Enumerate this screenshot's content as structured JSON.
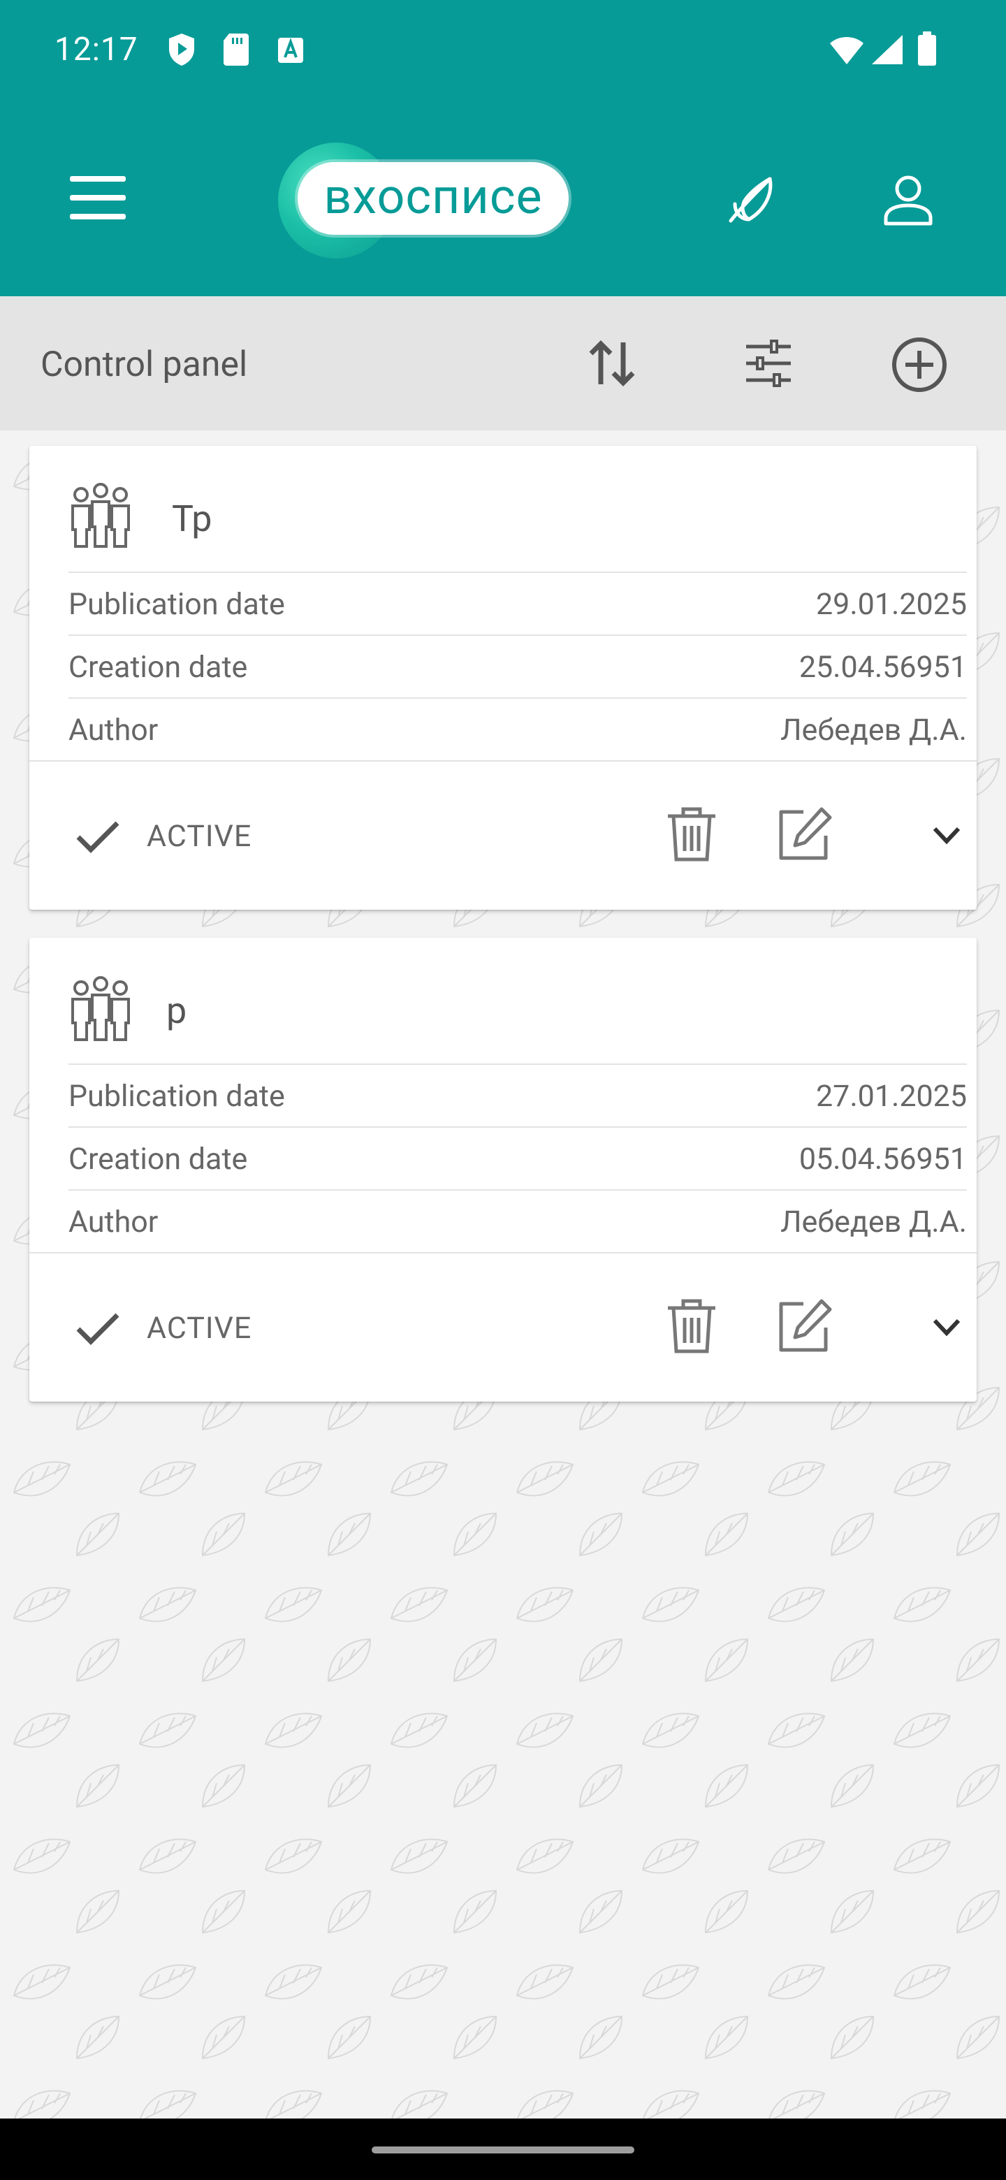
{
  "status_bar": {
    "time": "12:17"
  },
  "app_bar": {
    "logo_text": "вхосписе",
    "colors": {
      "primary": "#079b97"
    }
  },
  "toolbar": {
    "title": "Control panel"
  },
  "cards": [
    {
      "name": "Тр",
      "rows": [
        {
          "label": "Publication date",
          "value": "29.01.2025"
        },
        {
          "label": "Creation date",
          "value": "25.04.56951"
        },
        {
          "label": "Author",
          "value": "Лебедев Д.А."
        }
      ],
      "status": "ACTIVE"
    },
    {
      "name": "р",
      "rows": [
        {
          "label": "Publication date",
          "value": "27.01.2025"
        },
        {
          "label": "Creation date",
          "value": "05.04.56951"
        },
        {
          "label": "Author",
          "value": "Лебедев Д.А."
        }
      ],
      "status": "ACTIVE"
    }
  ]
}
